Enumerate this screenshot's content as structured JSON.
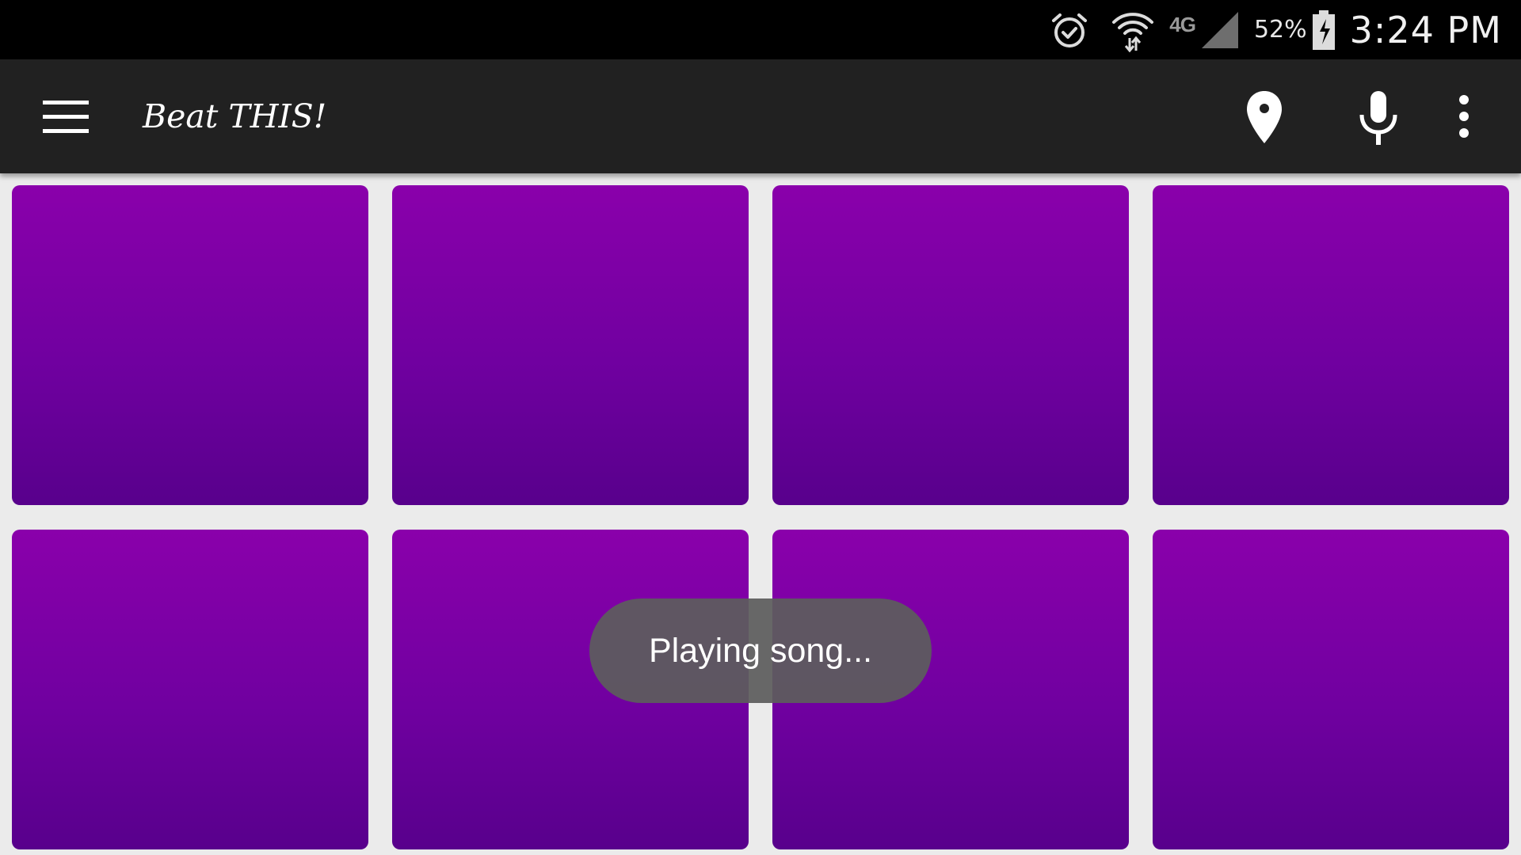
{
  "status_bar": {
    "icons": [
      "alarm-icon",
      "wifi-icon",
      "signal-icon",
      "battery-icon"
    ],
    "network_type": "4G",
    "battery_percent": "52%",
    "clock": "3:24 PM"
  },
  "app_bar": {
    "title": "Beat THIS!",
    "actions": [
      "location-pin-icon",
      "microphone-icon",
      "more-vert-icon"
    ]
  },
  "pads": {
    "count": 8,
    "gradient_top": "#8a00ab",
    "gradient_bottom": "#58008c"
  },
  "toast": {
    "message": "Playing song..."
  },
  "colors": {
    "status_bar_bg": "#000000",
    "app_bar_bg": "#212121",
    "page_bg": "#ebebeb"
  }
}
